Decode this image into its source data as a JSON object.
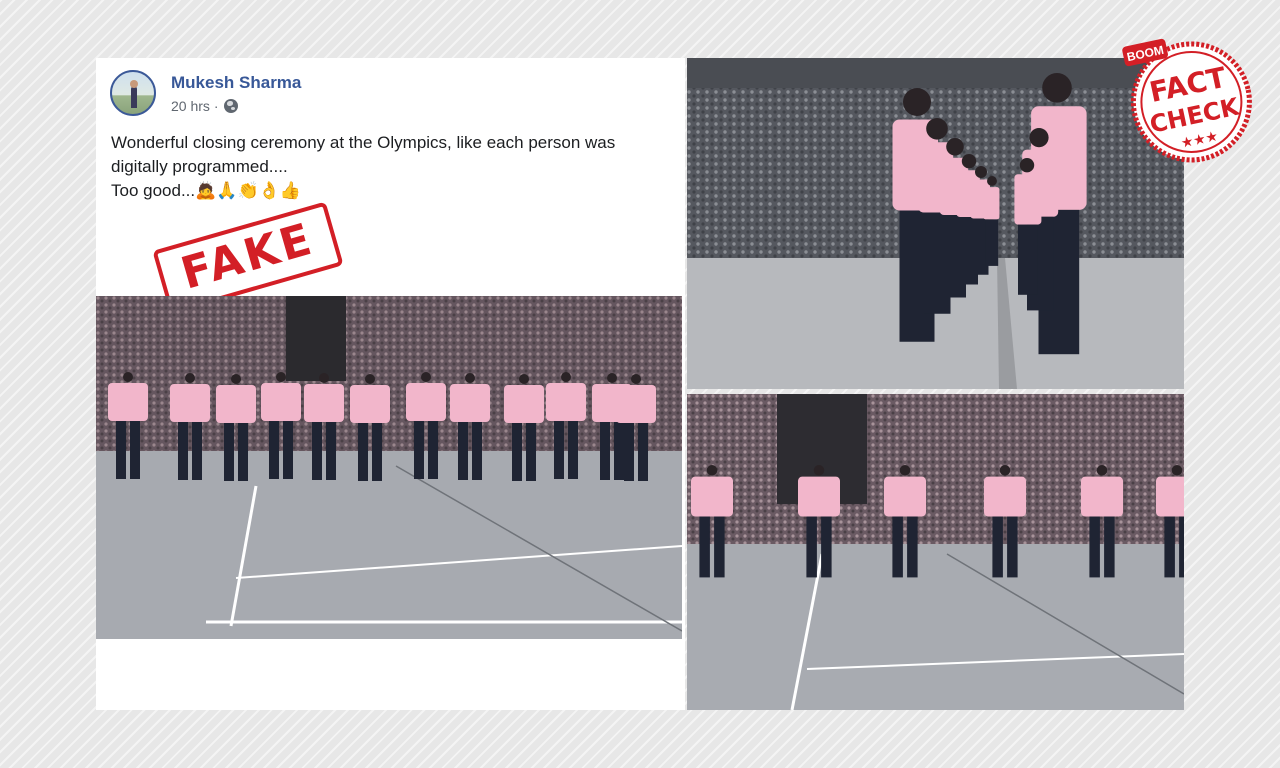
{
  "post": {
    "author": "Mukesh Sharma",
    "time": "20 hrs",
    "separator": "·",
    "text_lines": [
      "Wonderful closing ceremony at the Olympics, like each person was",
      "digitally programmed....",
      "Too good...🙇🙏👏👌👍"
    ]
  },
  "stamps": {
    "fake": "FAKE",
    "boom": "BOOM",
    "fact": "FACT",
    "check": "CHECK",
    "stars": "★★★"
  },
  "colors": {
    "brand_red": "#d31f26",
    "facebook_link": "#385898",
    "jacket_pink": "#f2b6cb",
    "trousers_navy": "#1f2433",
    "arena_floor": "#a7aab0"
  },
  "icons": {
    "privacy": "globe-icon",
    "avatar": "profile-photo"
  }
}
